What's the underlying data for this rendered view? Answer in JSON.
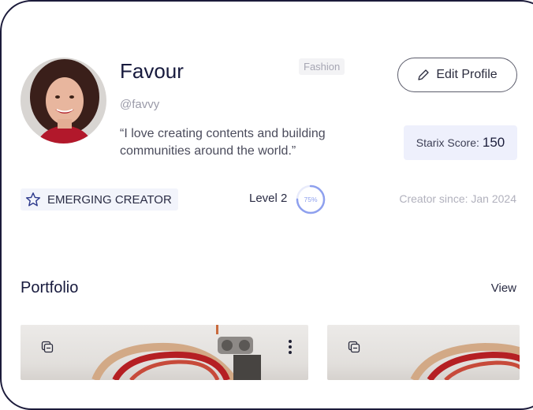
{
  "profile": {
    "name": "Favour",
    "handle": "@favvy",
    "bio": "“I love creating contents and building communities around the world.”",
    "category": "Fashion",
    "edit_label": "Edit Profile",
    "score_label": "Starix Score:",
    "score_value": "150",
    "badge_label": "EMERGING CREATOR",
    "level_label": "Level 2",
    "level_progress_label": "75%",
    "level_progress": 0.75,
    "creator_since": "Creator since: Jan 2024"
  },
  "portfolio": {
    "title": "Portfolio",
    "view_label": "View",
    "cards": [
      {
        "icon": "copy-icon",
        "menu_icon": "more-vertical-icon"
      },
      {
        "icon": "copy-icon"
      }
    ]
  },
  "colors": {
    "accent": "#7f93ea",
    "score_bg": "#eef0fc",
    "frame_border": "#1b1a3a"
  }
}
